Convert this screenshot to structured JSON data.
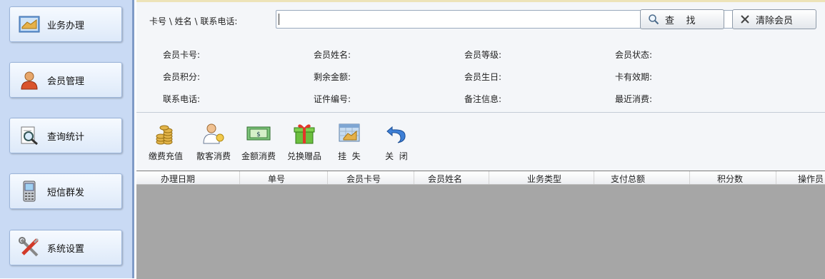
{
  "sidebar": {
    "items": [
      {
        "label": "业务办理",
        "icon": "handshake-icon"
      },
      {
        "label": "会员管理",
        "icon": "user-icon"
      },
      {
        "label": "查询统计",
        "icon": "magnifier-document-icon"
      },
      {
        "label": "短信群发",
        "icon": "mobile-phone-icon"
      },
      {
        "label": "系统设置",
        "icon": "tools-icon"
      }
    ]
  },
  "search": {
    "label": "卡号 \\ 姓名 \\ 联系电话:",
    "value": "",
    "search_button": "查    找",
    "clear_button": "清除会员"
  },
  "member_info": {
    "rows": [
      [
        "会员卡号:",
        "会员姓名:",
        "会员等级:",
        "会员状态:"
      ],
      [
        "会员积分:",
        "剩余金额:",
        "会员生日:",
        "卡有效期:"
      ],
      [
        "联系电话:",
        "证件编号:",
        "备注信息:",
        "最近消费:"
      ]
    ]
  },
  "toolbar": {
    "items": [
      {
        "label": "缴费充值",
        "icon": "coins-icon"
      },
      {
        "label": "散客消费",
        "icon": "guest-icon"
      },
      {
        "label": "金额消费",
        "icon": "banknote-icon"
      },
      {
        "label": "兑换赠品",
        "icon": "gift-icon"
      },
      {
        "label": "挂  失",
        "icon": "report-loss-icon"
      },
      {
        "label": "关  闭",
        "icon": "undo-close-icon"
      }
    ]
  },
  "table": {
    "columns": [
      "办理日期",
      "单号",
      "会员卡号",
      "会员姓名",
      "业务类型",
      "支付总额",
      "积分数",
      "操作员"
    ]
  }
}
